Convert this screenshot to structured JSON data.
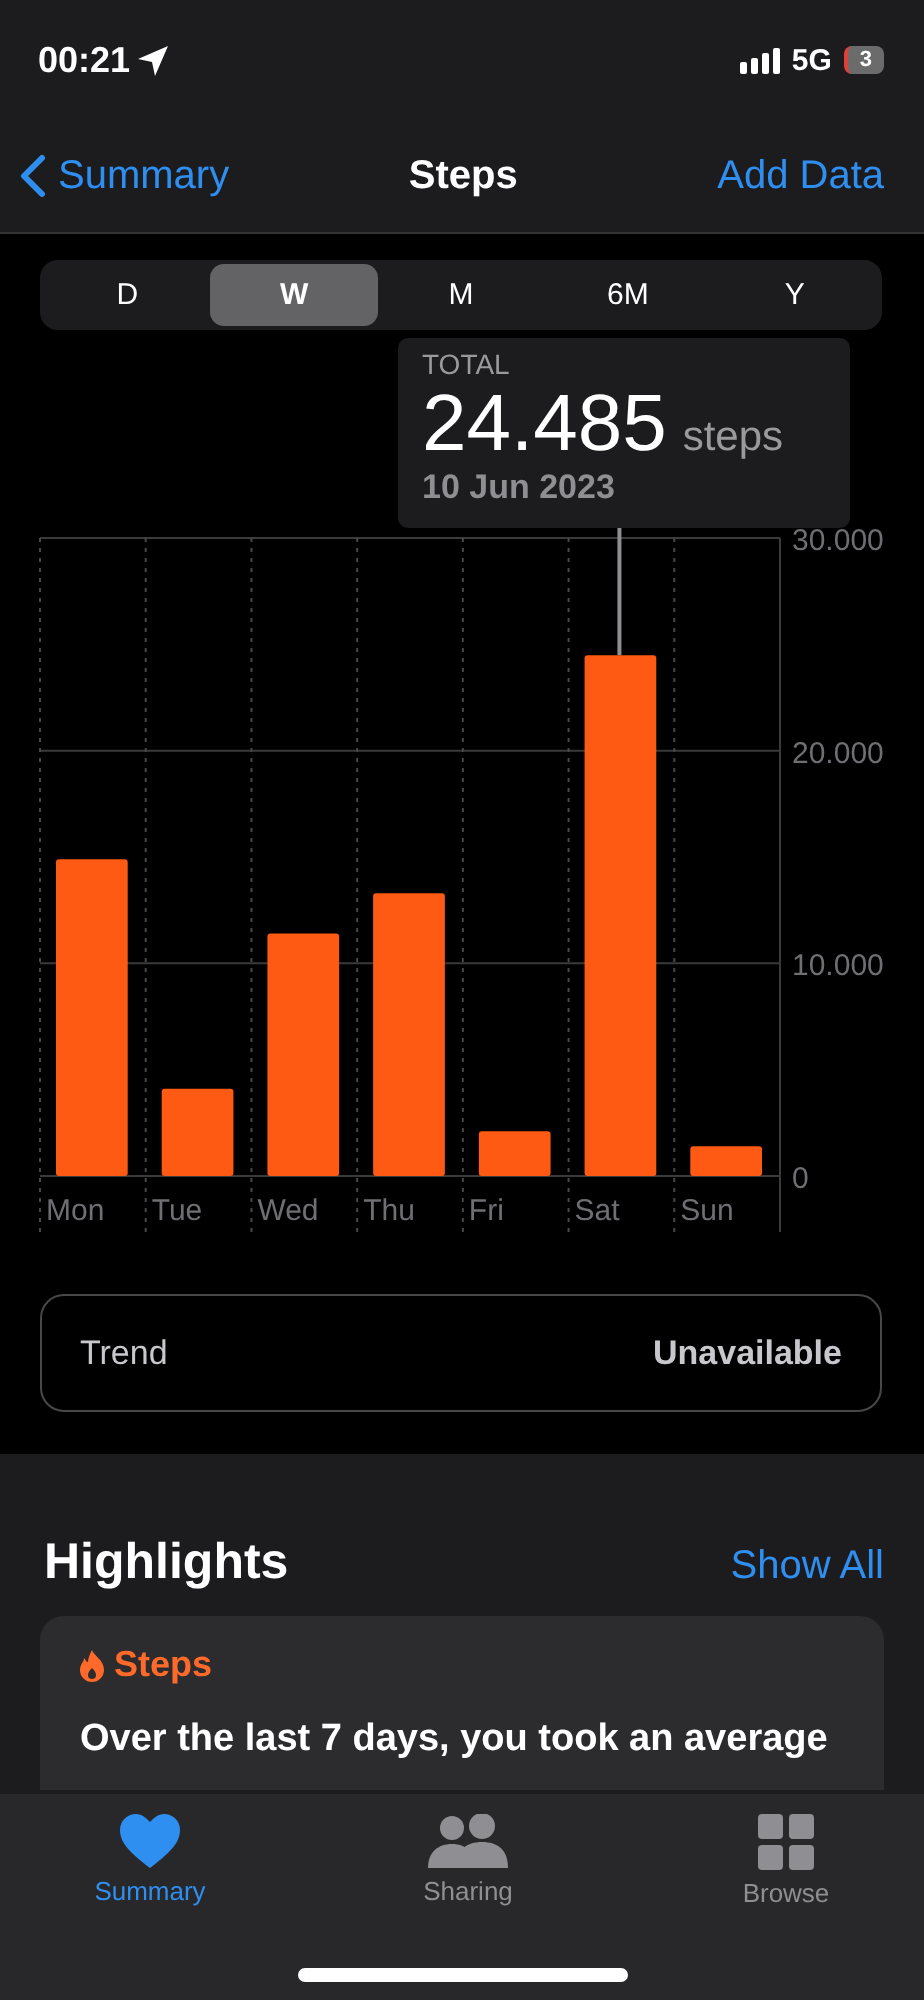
{
  "status_bar": {
    "time": "00:21",
    "network": "5G",
    "battery": "3"
  },
  "nav": {
    "back": "Summary",
    "title": "Steps",
    "action": "Add Data"
  },
  "segments": [
    {
      "label": "D",
      "selected": false
    },
    {
      "label": "W",
      "selected": true
    },
    {
      "label": "M",
      "selected": false
    },
    {
      "label": "6M",
      "selected": false
    },
    {
      "label": "Y",
      "selected": false
    }
  ],
  "tooltip": {
    "label": "TOTAL",
    "value": "24.485",
    "unit": "steps",
    "date": "10 Jun 2023"
  },
  "chart_data": {
    "type": "bar",
    "categories": [
      "Mon",
      "Tue",
      "Wed",
      "Thu",
      "Fri",
      "Sat",
      "Sun"
    ],
    "series": [
      {
        "color": "#ff5a13",
        "values": [
          14900,
          4100,
          11400,
          13300,
          2100,
          24485,
          1400
        ]
      }
    ],
    "ylim": [
      0,
      30000
    ],
    "yticks": [
      {
        "value": 0,
        "label": "0"
      },
      {
        "value": 10000,
        "label": "10.000"
      },
      {
        "value": 20000,
        "label": "20.000"
      },
      {
        "value": 30000,
        "label": "30.000"
      }
    ]
  },
  "trend": {
    "label": "Trend",
    "value": "Unavailable"
  },
  "highlights": {
    "title": "Highlights",
    "action": "Show All",
    "card": {
      "category": "Steps",
      "text": "Over the last 7 days, you took an average"
    }
  },
  "tab_bar": [
    {
      "label": "Summary",
      "selected": true
    },
    {
      "label": "Sharing",
      "selected": false
    },
    {
      "label": "Browse",
      "selected": false
    }
  ]
}
